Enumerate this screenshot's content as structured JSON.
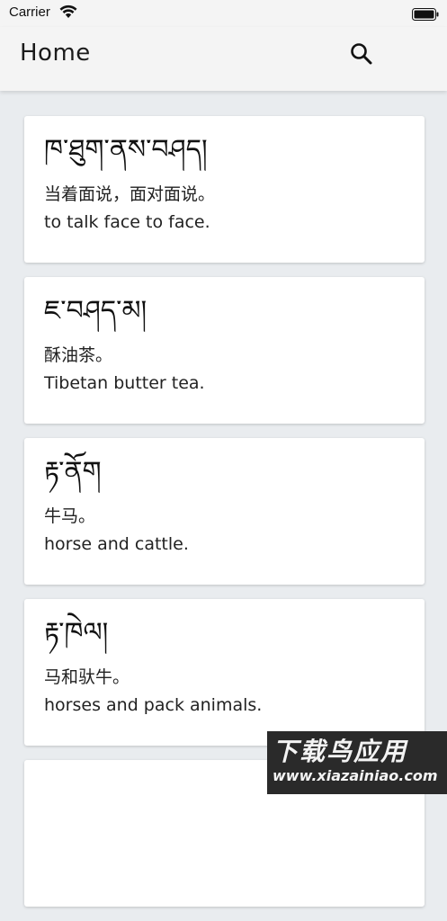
{
  "status_bar": {
    "carrier": "Carrier",
    "wifi_icon": "wifi-icon",
    "battery_icon": "battery-icon"
  },
  "app_bar": {
    "title": "Home",
    "search_icon": "search-icon"
  },
  "entries": [
    {
      "tibetan": "ཁ་ཐུག་ནས་བཤད།",
      "chinese": "当着面说，面对面说。",
      "english": "to talk face to face."
    },
    {
      "tibetan": "ཇ་བཤད་མ།",
      "chinese": "酥油茶。",
      "english": "Tibetan butter tea."
    },
    {
      "tibetan": "རྟ་ནོག",
      "chinese": "牛马。",
      "english": "horse and cattle."
    },
    {
      "tibetan": "རྟ་ཁེལ།",
      "chinese": "马和驮牛。",
      "english": "horses and pack animals."
    },
    {
      "tibetan": "",
      "chinese": "",
      "english": ""
    }
  ],
  "watermark": {
    "title": "下载鸟应用",
    "url": "www.xiazainiao.com"
  },
  "colors": {
    "background": "#e9ecef",
    "app_bar": "#f4f4f4",
    "card": "#ffffff",
    "text": "#222222"
  }
}
